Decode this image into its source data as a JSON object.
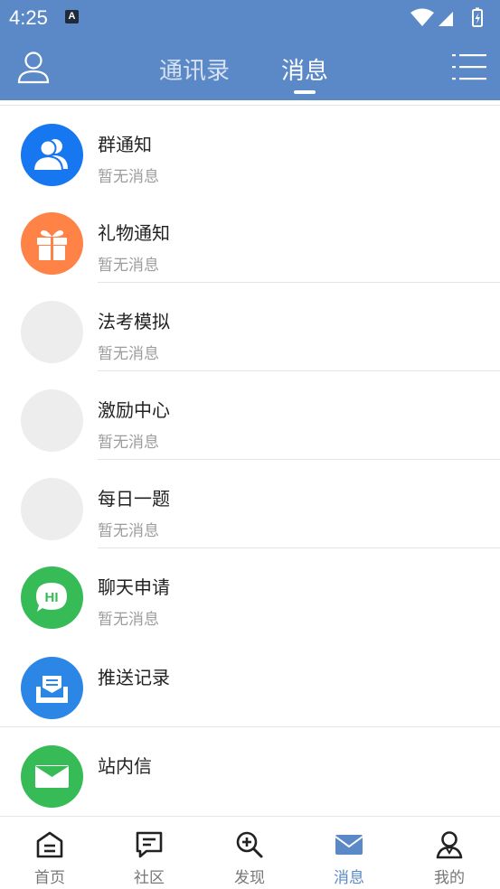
{
  "status_bar": {
    "time": "4:25",
    "badge": "A"
  },
  "header": {
    "tabs": [
      {
        "label": "通讯录",
        "active": false
      },
      {
        "label": "消息",
        "active": true
      }
    ]
  },
  "messages": [
    {
      "title": "群通知",
      "subtitle": "暂无消息",
      "icon": "group-icon",
      "color": "#1677f0"
    },
    {
      "title": "礼物通知",
      "subtitle": "暂无消息",
      "icon": "gift-icon",
      "color": "#ff8247"
    },
    {
      "title": "法考模拟",
      "subtitle": "暂无消息",
      "icon": "placeholder",
      "color": "#ededed"
    },
    {
      "title": "激励中心",
      "subtitle": "暂无消息",
      "icon": "placeholder",
      "color": "#ededed"
    },
    {
      "title": "每日一题",
      "subtitle": "暂无消息",
      "icon": "placeholder",
      "color": "#ededed"
    },
    {
      "title": "聊天申请",
      "subtitle": "暂无消息",
      "icon": "hi-chat-icon",
      "color": "#36bb57",
      "icon_text": "HI"
    },
    {
      "title": "推送记录",
      "subtitle": "",
      "icon": "inbox-icon",
      "color": "#2b86e6"
    },
    {
      "title": "站内信",
      "subtitle": "",
      "icon": "mail-icon",
      "color": "#36bb57"
    }
  ],
  "bottom_nav": [
    {
      "label": "首页",
      "icon": "home-icon",
      "active": false
    },
    {
      "label": "社区",
      "icon": "chat-bubble-icon",
      "active": false
    },
    {
      "label": "发现",
      "icon": "zoom-in-icon",
      "active": false
    },
    {
      "label": "消息",
      "icon": "envelope-icon",
      "active": true
    },
    {
      "label": "我的",
      "icon": "person-icon",
      "active": false
    }
  ],
  "colors": {
    "primary": "#5b89c7",
    "text": "#222222",
    "muted": "#9c9c9c"
  }
}
